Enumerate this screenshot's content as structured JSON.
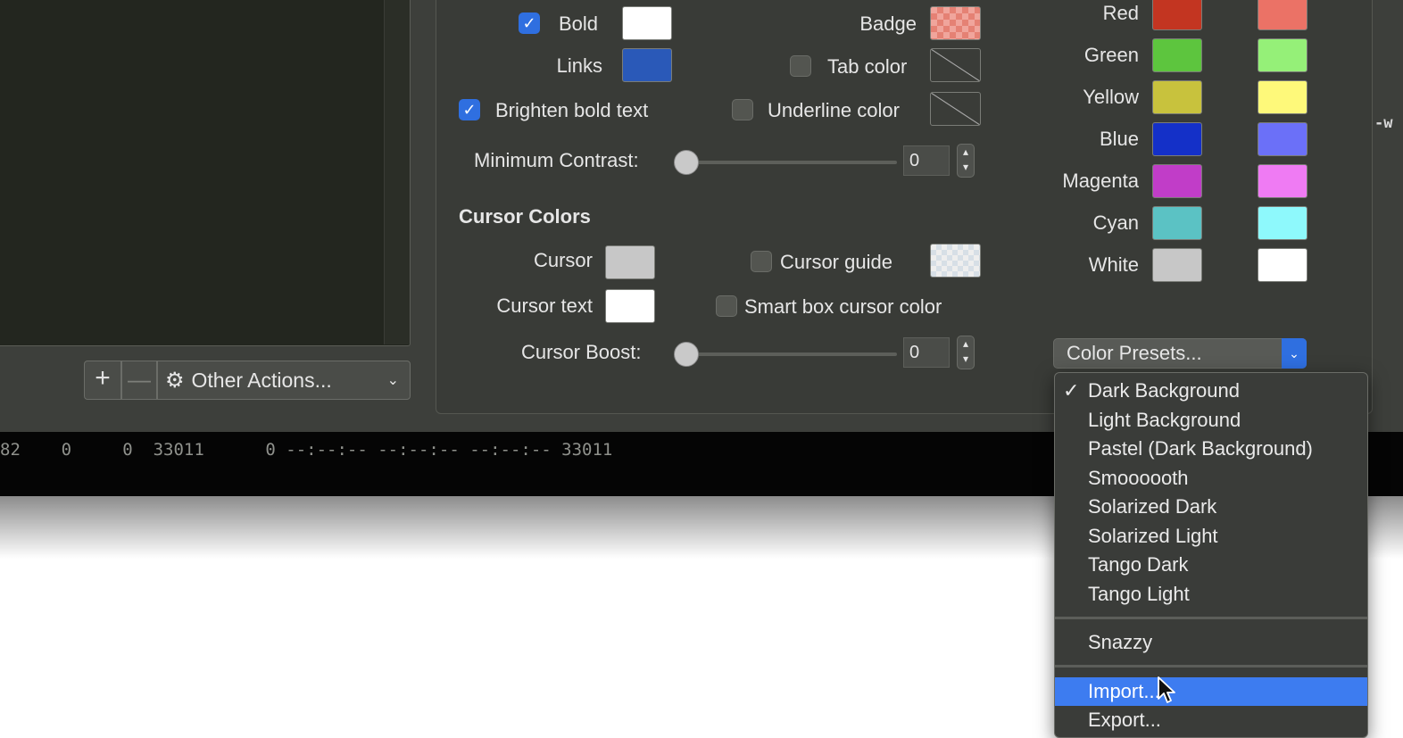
{
  "left_pane": {
    "add_label": "+",
    "remove_label": "—",
    "other_actions_label": "Other Actions..."
  },
  "text_colors": {
    "bold_label": "Bold",
    "links_label": "Links",
    "brighten_label": "Brighten bold text",
    "badge_label": "Badge",
    "tab_color_label": "Tab color",
    "underline_color_label": "Underline color",
    "min_contrast_label": "Minimum Contrast:",
    "min_contrast_value": "0",
    "bold_checked": true,
    "brighten_checked": true,
    "colors": {
      "bold": "#ffffff",
      "links": "#2a59b8"
    }
  },
  "cursor": {
    "section_title": "Cursor Colors",
    "cursor_label": "Cursor",
    "cursor_text_label": "Cursor text",
    "cursor_guide_label": "Cursor guide",
    "smart_box_label": "Smart box cursor color",
    "boost_label": "Cursor Boost:",
    "boost_value": "0",
    "colors": {
      "cursor": "#c7c7c7",
      "cursor_text": "#ffffff"
    }
  },
  "ansi": {
    "rows": [
      {
        "name": "Red",
        "normal": "#c33521",
        "bright": "#eb7266"
      },
      {
        "name": "Green",
        "normal": "#5dc53e",
        "bright": "#95f078"
      },
      {
        "name": "Yellow",
        "normal": "#c8c23d",
        "bright": "#fef97a"
      },
      {
        "name": "Blue",
        "normal": "#1430c8",
        "bright": "#6b70f8"
      },
      {
        "name": "Magenta",
        "normal": "#c13dc8",
        "bright": "#ef7bf3"
      },
      {
        "name": "Cyan",
        "normal": "#5bc2c4",
        "bright": "#8ef9fc"
      },
      {
        "name": "White",
        "normal": "#c7c7c7",
        "bright": "#ffffff"
      }
    ]
  },
  "presets": {
    "button_label": "Color Presets...",
    "items": [
      "Dark Background",
      "Light Background",
      "Pastel (Dark Background)",
      "Smoooooth",
      "Solarized Dark",
      "Solarized Light",
      "Tango Dark",
      "Tango Light"
    ],
    "checked_item": "Dark Background",
    "custom_items": [
      "Snazzy"
    ],
    "action_items": [
      "Import...",
      "Export..."
    ],
    "highlighted": "Import..."
  },
  "terminal": {
    "line": "82    0     0  33011      0 --:--:-- --:--:-- --:--:-- 33011",
    "edge_text": "-w"
  }
}
